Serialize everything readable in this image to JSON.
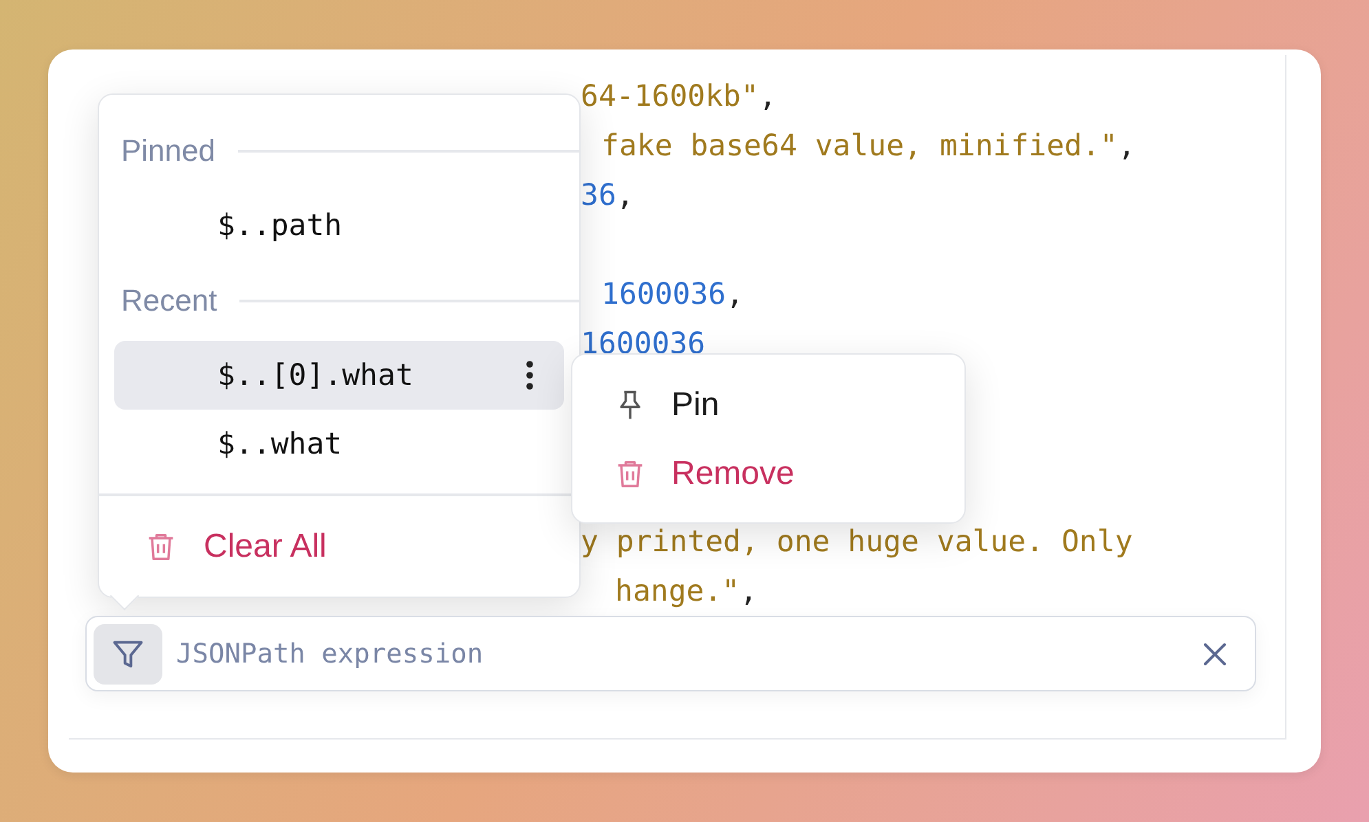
{
  "editor": {
    "lines": [
      {
        "tokens": [
          {
            "kind": "string",
            "text": "64-1600kb\""
          },
          {
            "kind": "punct",
            "text": ","
          }
        ]
      },
      {
        "tokens": [
          {
            "kind": "string",
            "text": "fake base64 value, minified.\""
          },
          {
            "kind": "punct",
            "text": ","
          }
        ]
      },
      {
        "tokens": [
          {
            "kind": "number",
            "text": "36"
          },
          {
            "kind": "punct",
            "text": ","
          }
        ]
      },
      {
        "tokens": [
          {
            "kind": "number",
            "text": "1600036"
          },
          {
            "kind": "punct",
            "text": ","
          }
        ]
      },
      {
        "tokens": [
          {
            "kind": "number",
            "text": "1600036"
          }
        ]
      },
      {
        "tokens": [
          {
            "kind": "string",
            "text": "y printed, one huge value. Only"
          }
        ]
      },
      {
        "tokens": [
          {
            "kind": "string",
            "text": "hange.\""
          },
          {
            "kind": "punct",
            "text": ","
          }
        ]
      }
    ]
  },
  "history_menu": {
    "sections": [
      {
        "heading": "Pinned",
        "items": [
          {
            "expression": "$..path",
            "selected": false
          }
        ]
      },
      {
        "heading": "Recent",
        "items": [
          {
            "expression": "$..[0].what",
            "selected": true
          },
          {
            "expression": "$..what",
            "selected": false
          }
        ]
      }
    ],
    "clear_all": "Clear All"
  },
  "context_menu": {
    "items": [
      {
        "kind": "pin",
        "label": "Pin"
      },
      {
        "kind": "remove",
        "label": "Remove"
      }
    ]
  },
  "filter_bar": {
    "placeholder": "JSONPath expression"
  }
}
